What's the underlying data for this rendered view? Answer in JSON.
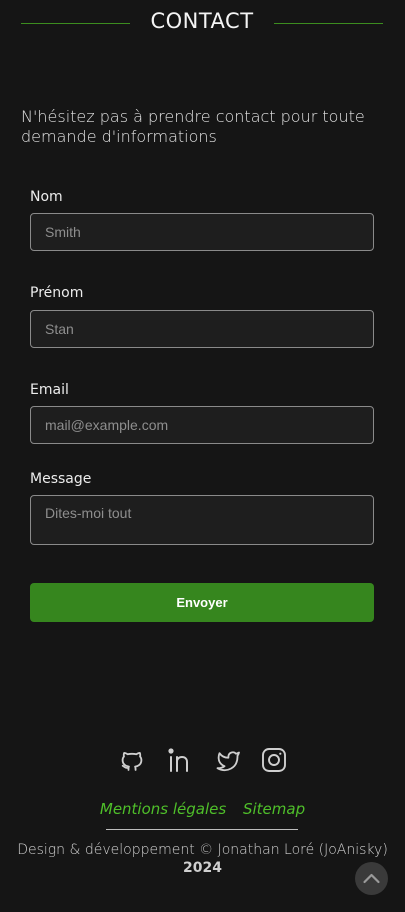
{
  "header": {
    "title": "CONTACT",
    "accent_color": "#3c8d1f"
  },
  "intro": {
    "text": "N'hésitez pas à prendre contact pour toute demande d'informations"
  },
  "form": {
    "nom": {
      "label": "Nom",
      "placeholder": "Smith"
    },
    "prenom": {
      "label": "Prénom",
      "placeholder": "Stan"
    },
    "email": {
      "label": "Email",
      "placeholder": "mail@example.com"
    },
    "message": {
      "label": "Message",
      "placeholder": "Dites-moi tout"
    },
    "submit_label": "Envoyer",
    "submit_color": "#36861e"
  },
  "socials": [
    {
      "name": "github-icon"
    },
    {
      "name": "linkedin-icon"
    },
    {
      "name": "twitter-icon"
    },
    {
      "name": "instagram-icon"
    }
  ],
  "footer": {
    "links": {
      "mentions": "Mentions légales",
      "sitemap": "Sitemap"
    },
    "link_color": "#4fbf2a",
    "credits": "Design & développement © Jonathan Loré (JoAnisky)",
    "year": "2024"
  }
}
